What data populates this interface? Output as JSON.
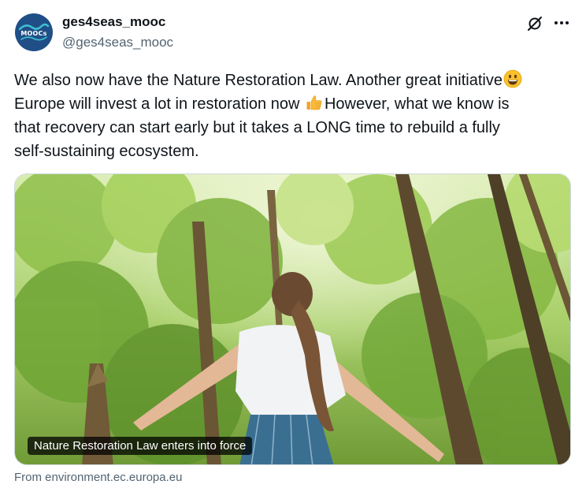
{
  "author": {
    "display_name": "ges4seas_mooc",
    "handle": "@ges4seas_mooc",
    "avatar_text": "MOOCs"
  },
  "tweet": {
    "lines": [
      "We also now have the Nature Restoration Law. Another great initiative",
      "Europe will invest a lot in restoration now",
      "However, what we know is",
      "that recovery can start early but it takes a LONG time to rebuild a fully",
      "self-sustaining ecosystem."
    ],
    "emojis": [
      "grinning-face-icon",
      "thumbs-up-icon"
    ]
  },
  "link_card": {
    "caption": "Nature Restoration Law enters into force",
    "source": "From environment.ec.europa.eu"
  },
  "icons": {
    "grok": "grok-icon",
    "more": "more-icon"
  },
  "colors": {
    "text": "#0f1419",
    "secondary": "#536471",
    "avatar_bg": "#1f4f86"
  }
}
